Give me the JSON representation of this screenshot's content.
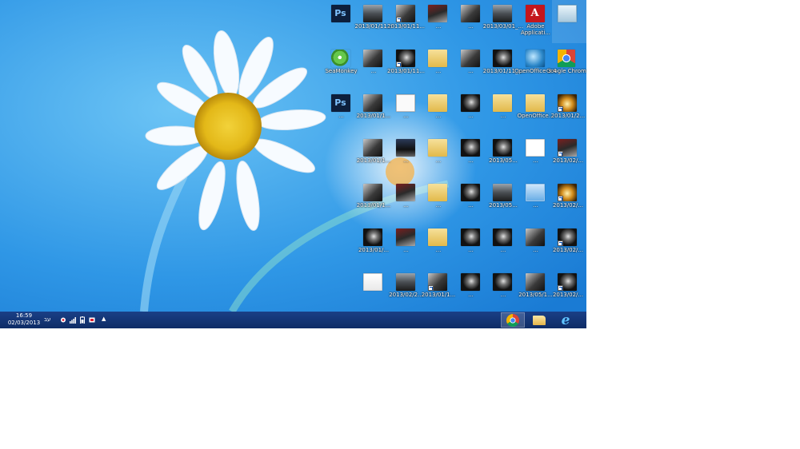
{
  "taskbar": {
    "time": "16:59",
    "date": "02/03/2013",
    "language": "עב",
    "pinned": [
      {
        "name": "google-chrome",
        "active": true
      },
      {
        "name": "file-explorer",
        "active": false
      },
      {
        "name": "internet-explorer",
        "active": false
      }
    ]
  },
  "desktop_icons": [
    {
      "label": "",
      "thumb": "t-trash",
      "col": 0,
      "row": 0,
      "icon": "recycle-bin-icon"
    },
    {
      "label": "Adobe Applicati...",
      "thumb": "t-adobe",
      "glyph": "A",
      "col": 1,
      "row": 0,
      "icon": "adobe-icon"
    },
    {
      "label": "2013/03/01_...",
      "thumb": "t-road",
      "col": 2,
      "row": 0,
      "icon": "image-icon"
    },
    {
      "label": "...",
      "thumb": "t-photo",
      "col": 3,
      "row": 0,
      "icon": "image-icon"
    },
    {
      "label": "...",
      "thumb": "t-car",
      "col": 4,
      "row": 0,
      "icon": "image-icon"
    },
    {
      "label": "2013/01/11...",
      "thumb": "t-photo",
      "col": 5,
      "row": 0,
      "shortcut": true,
      "icon": "image-icon"
    },
    {
      "label": "2013/01/11...",
      "thumb": "t-road",
      "col": 6,
      "row": 0,
      "icon": "image-icon"
    },
    {
      "label": "",
      "thumb": "t-ps",
      "glyph": "Ps",
      "col": 7,
      "row": 0,
      "icon": "photoshop-icon"
    },
    {
      "label": "Google Chrome",
      "thumb": "t-chrome",
      "col": 0,
      "row": 1,
      "icon": "chrome-icon"
    },
    {
      "label": "OpenOffice 3.4",
      "thumb": "t-oo",
      "col": 1,
      "row": 1,
      "icon": "openoffice-icon"
    },
    {
      "label": "2013/01/11_...",
      "thumb": "t-dark",
      "col": 2,
      "row": 1,
      "icon": "image-icon"
    },
    {
      "label": "...",
      "thumb": "t-photo",
      "col": 3,
      "row": 1,
      "icon": "image-icon"
    },
    {
      "label": "...",
      "thumb": "t-folder",
      "col": 4,
      "row": 1,
      "icon": "folder-icon"
    },
    {
      "label": "2013/01/11...",
      "thumb": "t-dark",
      "col": 5,
      "row": 1,
      "shortcut": true,
      "icon": "image-icon"
    },
    {
      "label": "...",
      "thumb": "t-photo",
      "col": 6,
      "row": 1,
      "icon": "image-icon"
    },
    {
      "label": "SeaMonkey",
      "thumb": "t-sea",
      "col": 7,
      "row": 1,
      "icon": "seamonkey-icon"
    },
    {
      "label": "2013/01/2...",
      "thumb": "t-gold",
      "col": 0,
      "row": 2,
      "shortcut": true,
      "icon": "image-icon"
    },
    {
      "label": "OpenOffice...",
      "thumb": "t-folder",
      "col": 1,
      "row": 2,
      "icon": "folder-icon"
    },
    {
      "label": "...",
      "thumb": "t-folder",
      "col": 2,
      "row": 2,
      "icon": "folder-icon"
    },
    {
      "label": "...",
      "thumb": "t-dark",
      "col": 3,
      "row": 2,
      "icon": "image-icon"
    },
    {
      "label": "...",
      "thumb": "t-folder",
      "col": 4,
      "row": 2,
      "icon": "folder-icon"
    },
    {
      "label": "...",
      "thumb": "t-doc",
      "col": 5,
      "row": 2,
      "icon": "document-icon"
    },
    {
      "label": "2013/01/1...",
      "thumb": "t-photo",
      "col": 6,
      "row": 2,
      "icon": "image-icon"
    },
    {
      "label": "...",
      "thumb": "t-ps",
      "glyph": "Ps",
      "col": 7,
      "row": 2,
      "icon": "photoshop-icon"
    },
    {
      "label": "2013/02/...",
      "thumb": "t-car",
      "col": 0,
      "row": 3,
      "shortcut": true,
      "icon": "image-icon"
    },
    {
      "label": "...",
      "thumb": "t-logo",
      "col": 1,
      "row": 3,
      "icon": "image-icon"
    },
    {
      "label": "2013/05...",
      "thumb": "t-dark",
      "col": 2,
      "row": 3,
      "icon": "image-icon"
    },
    {
      "label": "...",
      "thumb": "t-dark",
      "col": 3,
      "row": 3,
      "icon": "image-icon"
    },
    {
      "label": "...",
      "thumb": "t-folder",
      "col": 4,
      "row": 3,
      "icon": "folder-icon"
    },
    {
      "label": "...",
      "thumb": "t-city",
      "col": 5,
      "row": 3,
      "icon": "image-icon"
    },
    {
      "label": "2013/01/1...",
      "thumb": "t-photo",
      "col": 6,
      "row": 3,
      "icon": "image-icon"
    },
    {
      "label": "2013/02/...",
      "thumb": "t-gold",
      "col": 0,
      "row": 4,
      "shortcut": true,
      "icon": "image-icon"
    },
    {
      "label": "...",
      "thumb": "t-blue",
      "col": 1,
      "row": 4,
      "icon": "image-icon"
    },
    {
      "label": "2013/05...",
      "thumb": "t-road",
      "col": 2,
      "row": 4,
      "icon": "image-icon"
    },
    {
      "label": "...",
      "thumb": "t-dark",
      "col": 3,
      "row": 4,
      "icon": "image-icon"
    },
    {
      "label": "...",
      "thumb": "t-folder",
      "col": 4,
      "row": 4,
      "icon": "folder-icon"
    },
    {
      "label": "...",
      "thumb": "t-car",
      "col": 5,
      "row": 4,
      "icon": "image-icon"
    },
    {
      "label": "2013/01/1...",
      "thumb": "t-photo",
      "col": 6,
      "row": 4,
      "icon": "image-icon"
    },
    {
      "label": "2013/02/...",
      "thumb": "t-dark",
      "col": 0,
      "row": 5,
      "shortcut": true,
      "icon": "image-icon"
    },
    {
      "label": "...",
      "thumb": "t-photo",
      "col": 1,
      "row": 5,
      "icon": "image-icon"
    },
    {
      "label": "...",
      "thumb": "t-dark",
      "col": 2,
      "row": 5,
      "icon": "image-icon"
    },
    {
      "label": "...",
      "thumb": "t-dark",
      "col": 3,
      "row": 5,
      "icon": "image-icon"
    },
    {
      "label": "...",
      "thumb": "t-folder",
      "col": 4,
      "row": 5,
      "icon": "folder-icon"
    },
    {
      "label": "...",
      "thumb": "t-car",
      "col": 5,
      "row": 5,
      "icon": "image-icon"
    },
    {
      "label": "2013/01/...",
      "thumb": "t-dark",
      "col": 6,
      "row": 5,
      "icon": "image-icon"
    },
    {
      "label": "2013/02/...",
      "thumb": "t-dark",
      "col": 0,
      "row": 6,
      "shortcut": true,
      "icon": "image-icon"
    },
    {
      "label": "2013/05/1...",
      "thumb": "t-photo",
      "col": 1,
      "row": 6,
      "icon": "image-icon"
    },
    {
      "label": "...",
      "thumb": "t-dark",
      "col": 2,
      "row": 6,
      "icon": "image-icon"
    },
    {
      "label": "...",
      "thumb": "t-dark",
      "col": 3,
      "row": 6,
      "icon": "image-icon"
    },
    {
      "label": "2013/01/1...",
      "thumb": "t-photo",
      "col": 4,
      "row": 6,
      "shortcut": true,
      "icon": "image-icon"
    },
    {
      "label": "2013/02/2...",
      "thumb": "t-road",
      "col": 5,
      "row": 6,
      "icon": "image-icon"
    },
    {
      "label": "",
      "thumb": "t-paper",
      "col": 6,
      "row": 6,
      "icon": "document-icon"
    }
  ]
}
